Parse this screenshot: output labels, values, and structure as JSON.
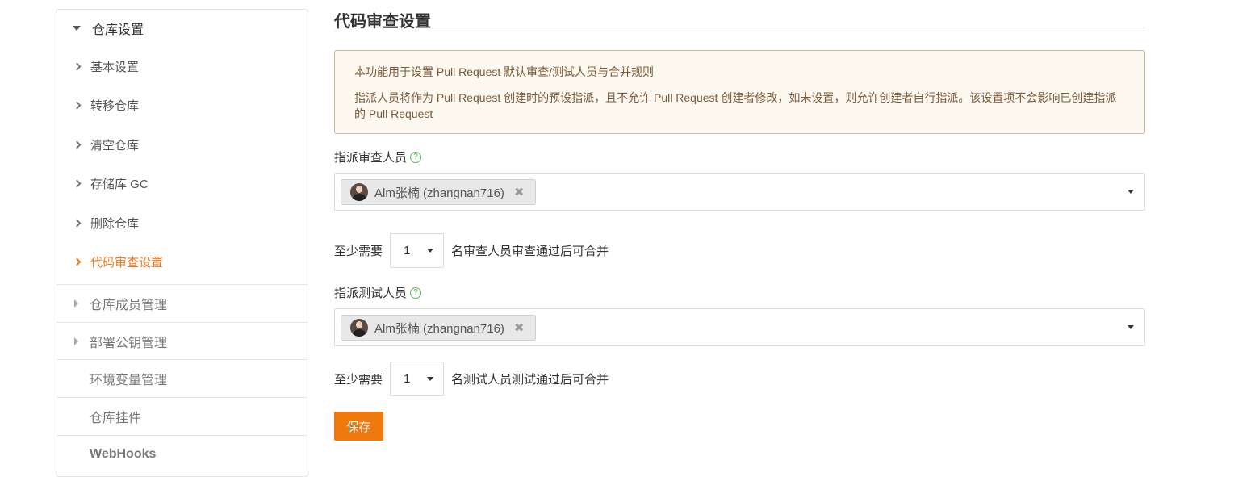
{
  "sidebar": {
    "header": "仓库设置",
    "sub_items": [
      {
        "label": "基本设置",
        "active": false
      },
      {
        "label": "转移仓库",
        "active": false
      },
      {
        "label": "清空仓库",
        "active": false
      },
      {
        "label": "存储库 GC",
        "active": false
      },
      {
        "label": "删除仓库",
        "active": false
      },
      {
        "label": "代码审查设置",
        "active": true
      }
    ],
    "sections": [
      {
        "label": "仓库成员管理"
      },
      {
        "label": "部署公钥管理"
      },
      {
        "label": "环境变量管理"
      },
      {
        "label": "仓库挂件"
      },
      {
        "label": "WebHooks"
      }
    ]
  },
  "main": {
    "title": "代码审查设置",
    "notice": {
      "line1": "本功能用于设置 Pull Request 默认审查/测试人员与合并规则",
      "line2": "指派人员将作为 Pull Request 创建时的预设指派，且不允许 Pull Request 创建者修改，如未设置，则允许创建者自行指派。该设置项不会影响已创建指派的 Pull Request"
    },
    "reviewers": {
      "label": "指派审查人员",
      "help_icon": "question-circle-icon",
      "selected": "Alm张楠 (zhangnan716)"
    },
    "reviewer_count": {
      "prefix": "至少需要",
      "value": "1",
      "suffix": "名审查人员审查通过后可合并"
    },
    "testers": {
      "label": "指派测试人员",
      "help_icon": "question-circle-icon",
      "selected": "Alm张楠 (zhangnan716)"
    },
    "tester_count": {
      "prefix": "至少需要",
      "value": "1",
      "suffix": "名测试人员测试通过后可合并"
    },
    "save_label": "保存"
  },
  "colors": {
    "accent": "#f0790e",
    "notice_bg": "#fdf8f0",
    "notice_text": "#7a5a38",
    "help_green": "#5cb85c"
  }
}
